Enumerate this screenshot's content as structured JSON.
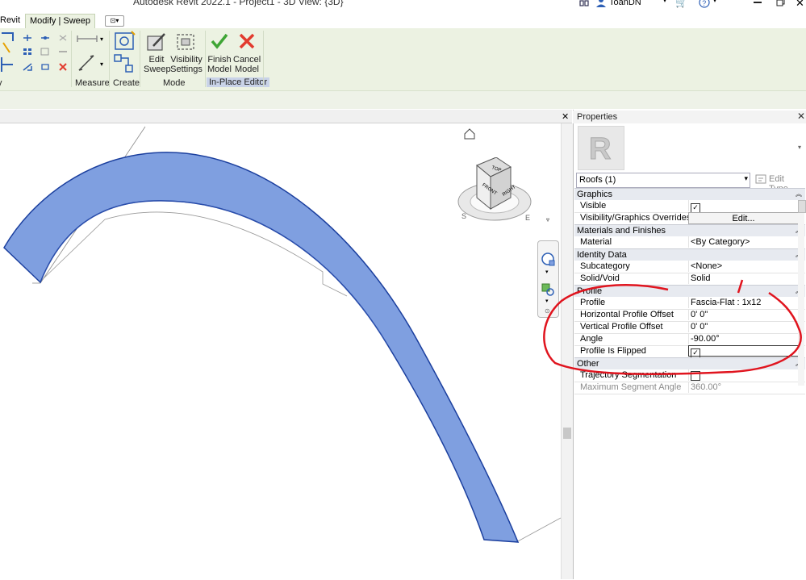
{
  "window": {
    "title": "Autodesk Revit 2022.1 - Project1 - 3D View: {3D}",
    "user": "ToanDN",
    "help_icon": "question-circle-icon"
  },
  "tabs": [
    {
      "label": "Revit"
    },
    {
      "label": "Modify | Sweep",
      "active": true
    }
  ],
  "ribbon": {
    "panels": {
      "modify": "fy",
      "measure": "Measure",
      "create": "Create",
      "mode": "Mode",
      "in_place_editor": "In-Place Editor"
    },
    "buttons": {
      "edit_sweep": [
        "Edit",
        "Sweep"
      ],
      "visibility_settings": [
        "Visibility",
        "Settings"
      ],
      "finish_model": [
        "Finish",
        "Model"
      ],
      "cancel_model": [
        "Cancel",
        "Model"
      ]
    },
    "colors": {
      "accent_green": "#3fa535",
      "accent_red": "#e23b2e",
      "ribbon_bg": "#ecf2e2"
    }
  },
  "viewcube": {
    "top": "TOP",
    "front": "FRONT",
    "right": "RIGHT",
    "compass_s": "S",
    "compass_e": "E"
  },
  "properties": {
    "title": "Properties",
    "type_selector": "Roofs (1)",
    "edit_type": "Edit Type",
    "groups": [
      {
        "name": "Graphics",
        "rows": [
          {
            "key": "Visible",
            "value": "",
            "checkbox": true,
            "checked": true
          },
          {
            "key": "Visibility/Graphics Overrides",
            "value": "Edit...",
            "button": true
          }
        ]
      },
      {
        "name": "Materials and Finishes",
        "rows": [
          {
            "key": "Material",
            "value": "<By Category>"
          }
        ]
      },
      {
        "name": "Identity Data",
        "rows": [
          {
            "key": "Subcategory",
            "value": "<None>"
          },
          {
            "key": "Solid/Void",
            "value": "Solid"
          }
        ]
      },
      {
        "name": "Profile",
        "rows": [
          {
            "key": "Profile",
            "value": "Fascia-Flat : 1x12"
          },
          {
            "key": "Horizontal Profile Offset",
            "value": "0'  0\""
          },
          {
            "key": "Vertical Profile Offset",
            "value": "0'  0\""
          },
          {
            "key": "Angle",
            "value": "-90.00°"
          },
          {
            "key": "Profile Is Flipped",
            "value": "",
            "checkbox": true,
            "checked": true
          }
        ]
      },
      {
        "name": "Other",
        "rows": [
          {
            "key": "Trajectory Segmentation",
            "value": "",
            "checkbox": true,
            "checked": false
          },
          {
            "key": "Maximum Segment Angle",
            "value": "360.00°",
            "muted": true
          }
        ]
      }
    ]
  },
  "annotation": {
    "color": "#e0141e"
  }
}
